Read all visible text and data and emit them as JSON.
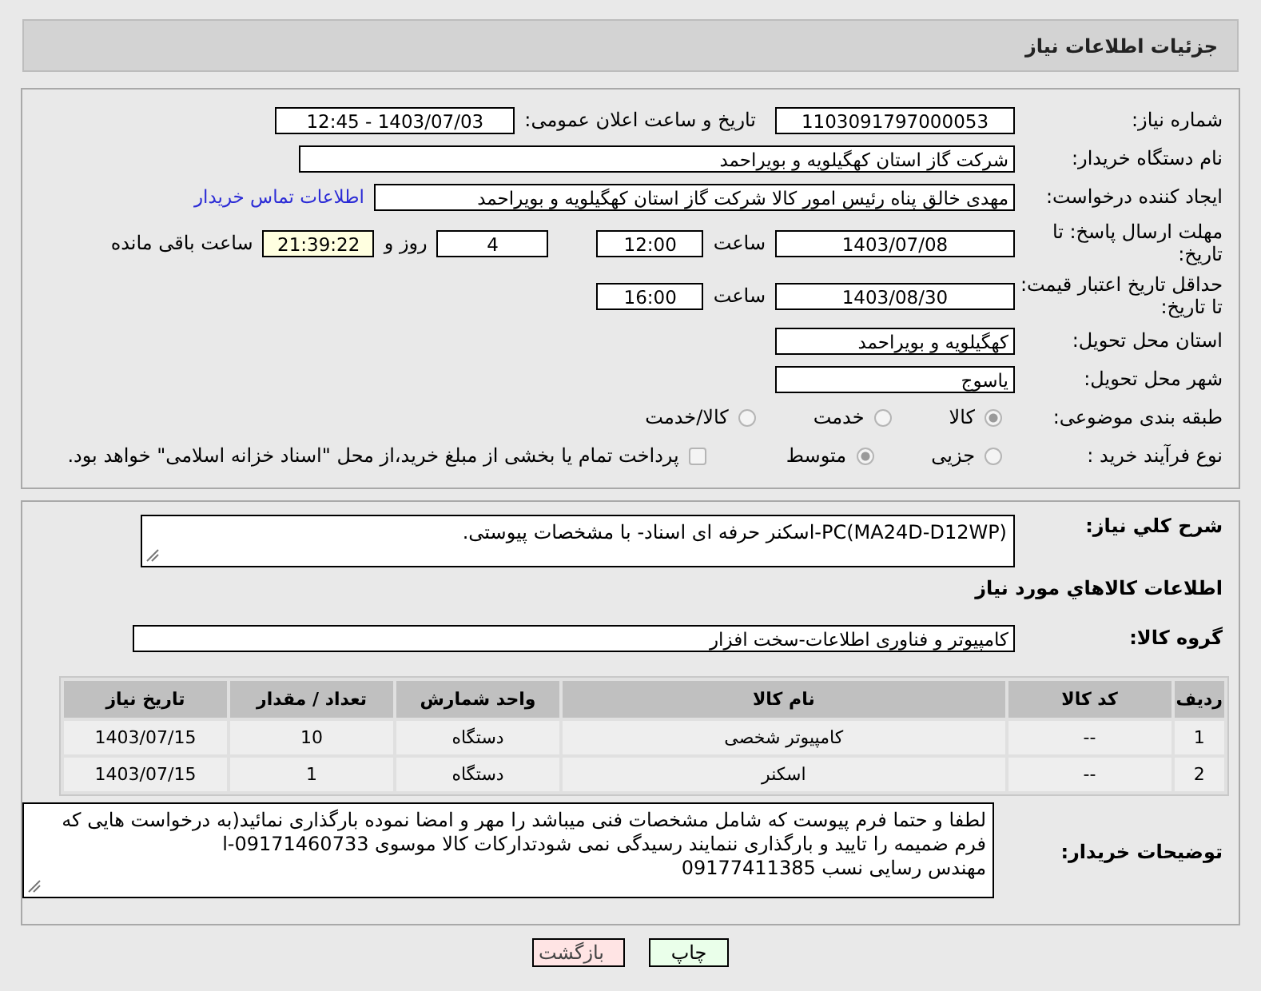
{
  "header": {
    "title": "جزئیات اطلاعات نیاز"
  },
  "need_number": {
    "label": "شماره نیاز:",
    "value": "1103091797000053"
  },
  "announce": {
    "label": "تاریخ و ساعت اعلان عمومی:",
    "value": "1403/07/03 - 12:45"
  },
  "buyer_org": {
    "label": "نام دستگاه خریدار:",
    "value": "شرکت گاز استان کهگیلویه و بویراحمد"
  },
  "requester": {
    "label": "ایجاد کننده درخواست:",
    "value": "مهدی خالق پناه رئیس امور کالا شرکت گاز استان کهگیلویه و بویراحمد",
    "link": "اطلاعات تماس خریدار"
  },
  "reply_deadline": {
    "label": "مهلت ارسال پاسخ: تا تاریخ:",
    "date": "1403/07/08",
    "time_label": "ساعت",
    "time": "12:00",
    "days": "4",
    "days_label": "روز و",
    "remaining": "21:39:22",
    "remaining_label": "ساعت باقی مانده"
  },
  "price_validity": {
    "label": "حداقل تاریخ اعتبار قیمت: تا تاریخ:",
    "date": "1403/08/30",
    "time_label": "ساعت",
    "time": "16:00"
  },
  "province": {
    "label": "استان محل تحویل:",
    "value": "کهگیلویه و بویراحمد"
  },
  "city": {
    "label": "شهر محل تحویل:",
    "value": "یاسوج"
  },
  "category": {
    "label": "طبقه بندی موضوعی:",
    "options": [
      {
        "label": "کالا",
        "selected": true
      },
      {
        "label": "خدمت",
        "selected": false
      },
      {
        "label": "کالا/خدمت",
        "selected": false
      }
    ]
  },
  "process": {
    "label": "نوع فرآیند خرید :",
    "options": [
      {
        "label": "جزیی",
        "selected": false
      },
      {
        "label": "متوسط",
        "selected": true
      }
    ],
    "treasury": {
      "checked": false,
      "label": "پرداخت تمام یا بخشی از مبلغ خرید،از محل \"اسناد خزانه اسلامی\" خواهد بود."
    }
  },
  "description": {
    "label": "شرح کلي نياز:",
    "value": "PC(MA24D-D12WP)-اسکنر حرفه ای اسناد- با مشخصات پیوستی."
  },
  "goods_heading": "اطلاعات کالاهاي مورد نياز",
  "goods_group": {
    "label": "گروه کالا:",
    "value": "کامپیوتر و فناوری اطلاعات-سخت افزار"
  },
  "table": {
    "columns": [
      "ردیف",
      "کد کالا",
      "نام کالا",
      "واحد شمارش",
      "تعداد / مقدار",
      "تاریخ نیاز"
    ],
    "rows": [
      [
        "1",
        "--",
        "کامپیوتر شخصی",
        "دستگاه",
        "10",
        "1403/07/15"
      ],
      [
        "2",
        "--",
        "اسکنر",
        "دستگاه",
        "1",
        "1403/07/15"
      ]
    ]
  },
  "buyer_notes": {
    "label": "توضیحات خریدار:",
    "value": "لطفا و حتما فرم پیوست که شامل مشخصات فنی میباشد را مهر و امضا نموده بارگذاری نمائید(به درخواست هایی که فرم ضمیمه را تایید و بارگذاری ننمایند رسیدگی نمی شودتدارکات کالا موسوی 09171460733-ا\nمهندس رسایی نسب 09177411385"
  },
  "buttons": [
    {
      "label": "چاپ",
      "kind": "print"
    },
    {
      "label": "بازگشت",
      "kind": "back"
    }
  ]
}
